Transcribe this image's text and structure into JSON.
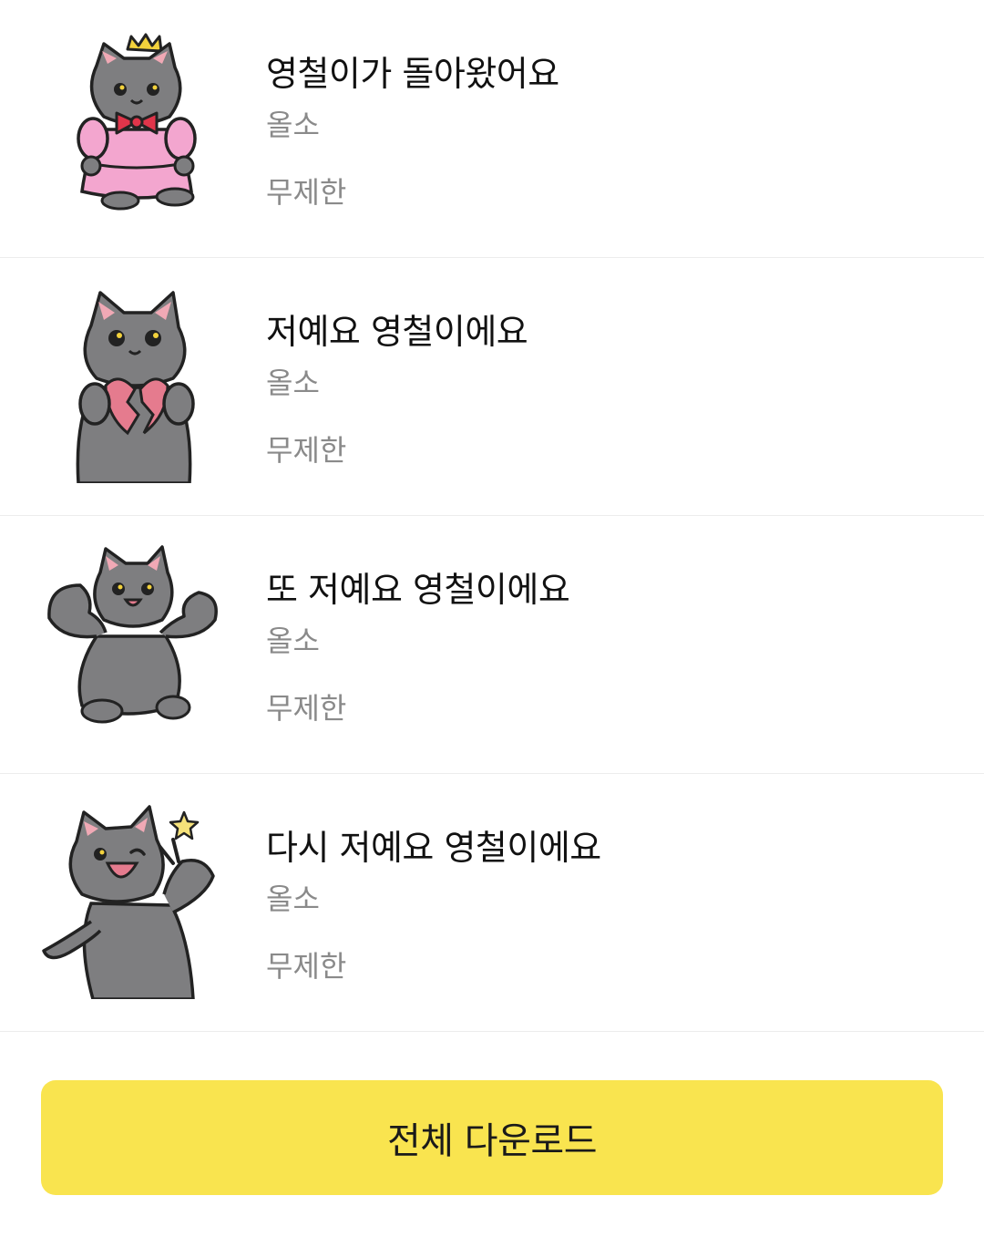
{
  "stickers": [
    {
      "title": "영철이가 돌아왔어요",
      "author": "올소",
      "period": "무제한",
      "icon": "cat-princess-icon"
    },
    {
      "title": "저예요 영철이에요",
      "author": "올소",
      "period": "무제한",
      "icon": "cat-broken-heart-icon"
    },
    {
      "title": "또 저예요 영철이에요",
      "author": "올소",
      "period": "무제한",
      "icon": "cat-flexing-icon"
    },
    {
      "title": "다시 저예요 영철이에요",
      "author": "올소",
      "period": "무제한",
      "icon": "cat-peace-sign-icon"
    }
  ],
  "download_button": {
    "label": "전체 다운로드"
  },
  "colors": {
    "accent": "#f9e44f",
    "cat_body": "#7e7e80",
    "dress_pink": "#f3a6cf",
    "heart_pink": "#e57b8e",
    "star_yellow": "#f6e27a"
  }
}
